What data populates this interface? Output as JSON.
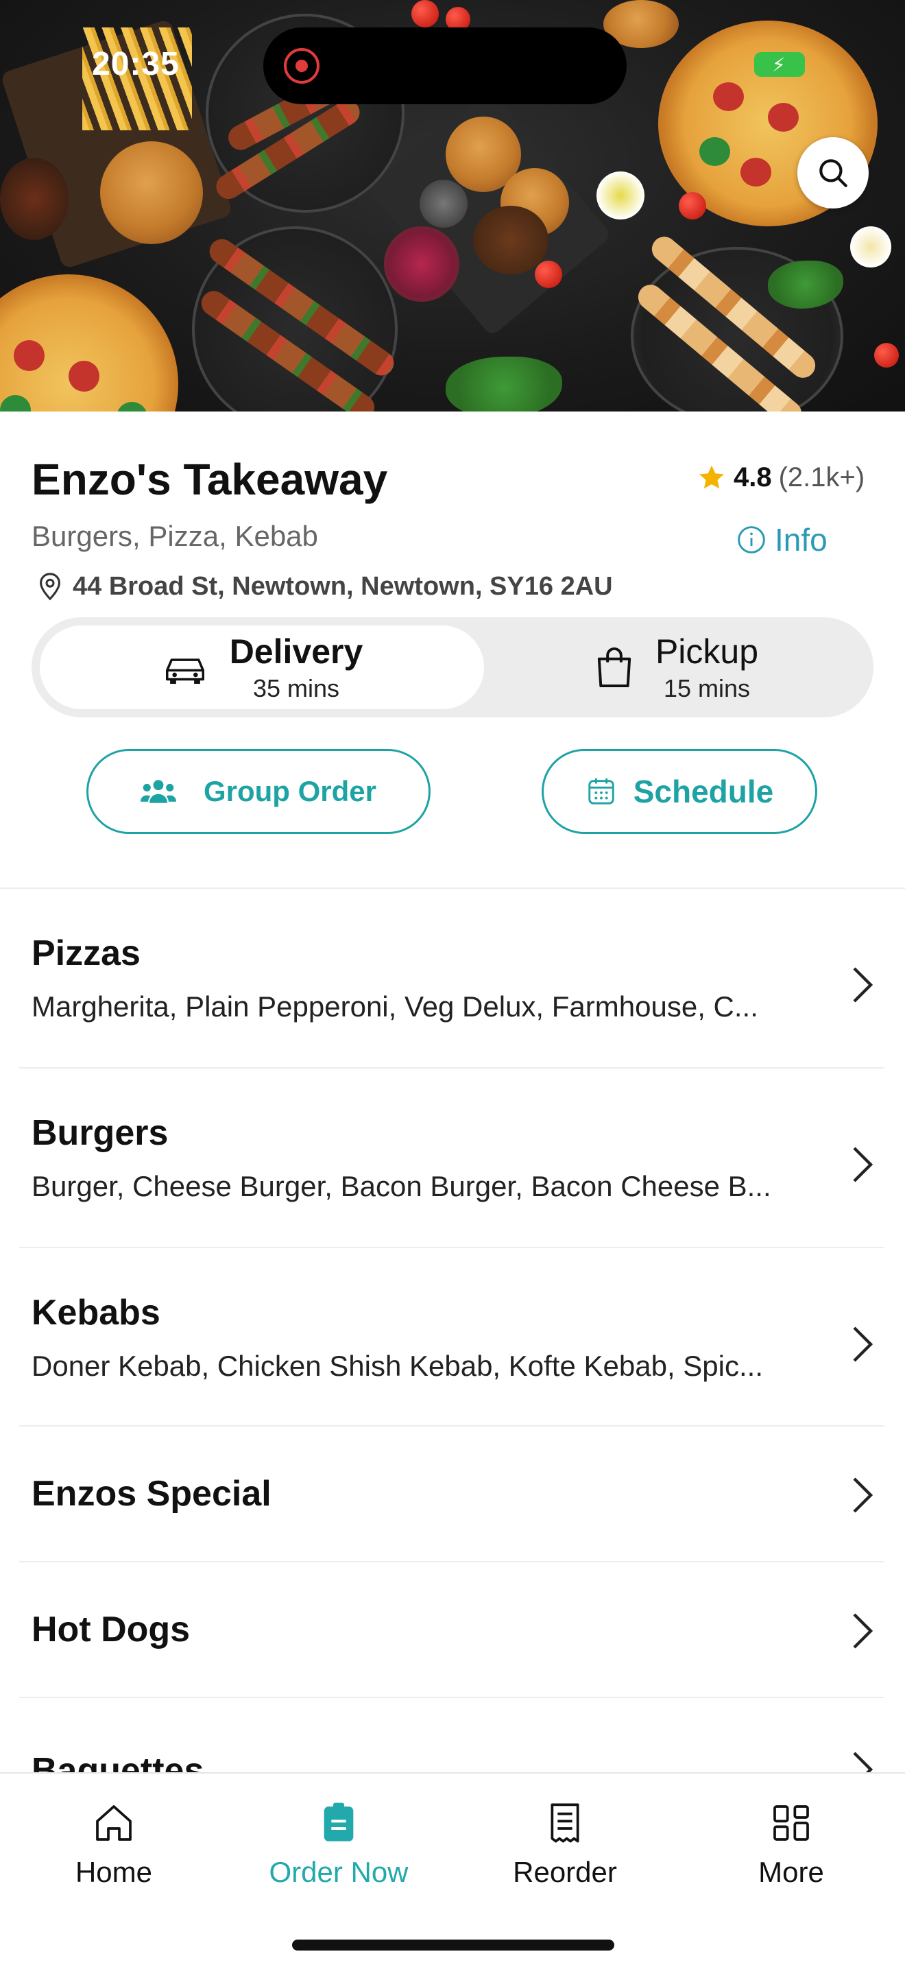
{
  "status_bar": {
    "time": "20:35"
  },
  "hero": {
    "search_icon": "search-icon"
  },
  "restaurant": {
    "name": "Enzo's Takeaway",
    "rating": "4.8",
    "rating_count": "(2.1k+)",
    "cuisines": "Burgers, Pizza, Kebab",
    "info_label": "Info",
    "address": "44 Broad St, Newtown, Newtown, SY16 2AU"
  },
  "fulfilment": {
    "selected": "delivery",
    "delivery": {
      "label": "Delivery",
      "time": "35 mins"
    },
    "pickup": {
      "label": "Pickup",
      "time": "15 mins"
    }
  },
  "actions": {
    "group_order": "Group Order",
    "schedule": "Schedule"
  },
  "categories": [
    {
      "title": "Pizzas",
      "items": "Margherita, Plain Pepperoni, Veg Delux, Farmhouse, C..."
    },
    {
      "title": "Burgers",
      "items": "Burger, Cheese Burger, Bacon Burger, Bacon Cheese B..."
    },
    {
      "title": "Kebabs",
      "items": "Doner Kebab, Chicken Shish Kebab, Kofte Kebab, Spic..."
    },
    {
      "title": "Enzos Special"
    },
    {
      "title": "Hot Dogs"
    },
    {
      "title": "Baguettes"
    }
  ],
  "tabbar": {
    "active": "order_now",
    "home": "Home",
    "order_now": "Order Now",
    "reorder": "Reorder",
    "more": "More"
  },
  "colors": {
    "accent": "#1ea3a5",
    "info": "#2a9ab4",
    "star": "#f5b301"
  }
}
